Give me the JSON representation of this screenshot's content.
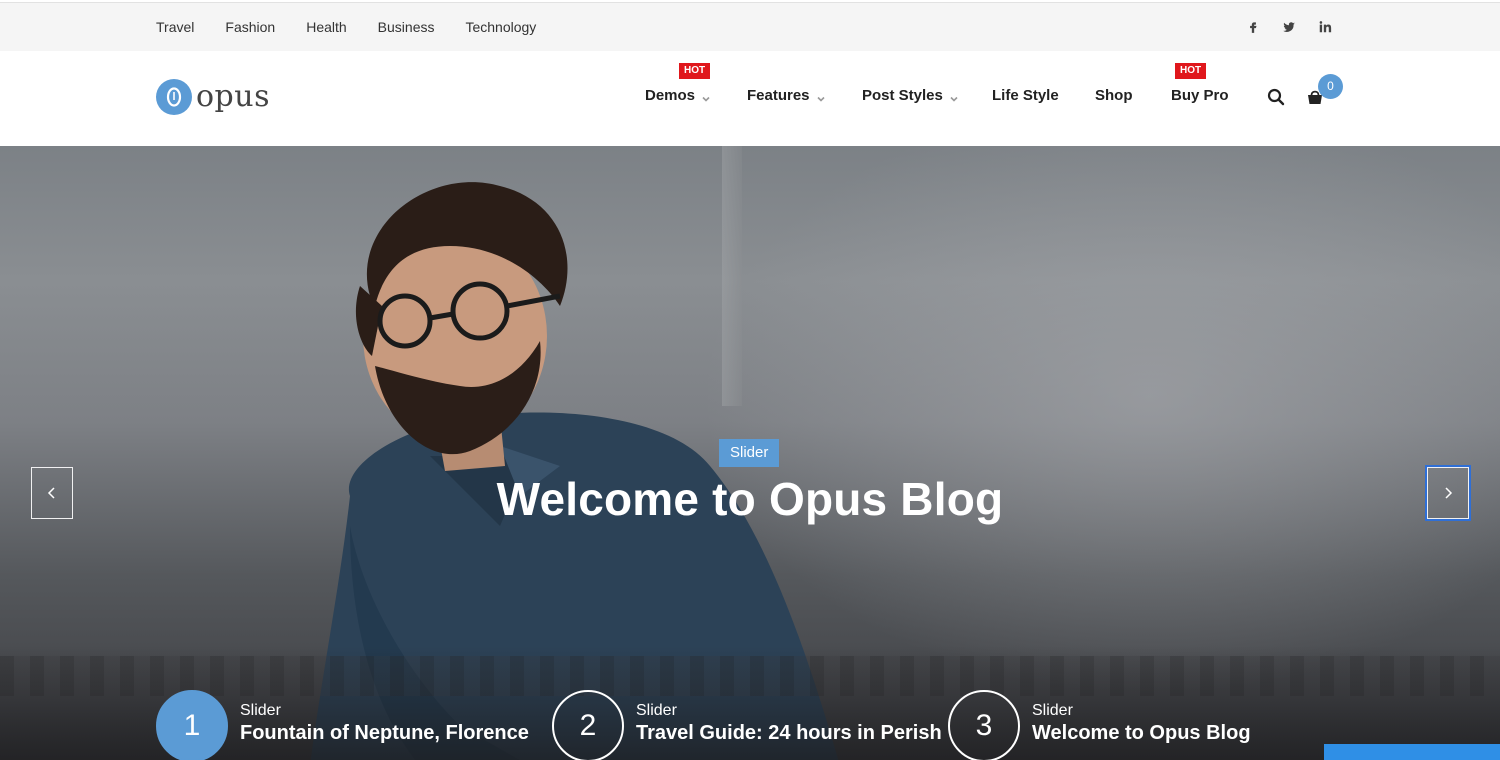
{
  "topbar": {
    "links": [
      "Travel",
      "Fashion",
      "Health",
      "Business",
      "Technology"
    ],
    "social_icons": [
      "facebook-icon",
      "twitter-icon",
      "linkedin-icon"
    ]
  },
  "header": {
    "logo_text": "opus",
    "nav": {
      "demos": {
        "label": "Demos",
        "badge": "HOT"
      },
      "features": {
        "label": "Features"
      },
      "post_styles": {
        "label": "Post Styles"
      },
      "life_style": {
        "label": "Life Style"
      },
      "shop": {
        "label": "Shop"
      },
      "buy_pro": {
        "label": "Buy Pro",
        "badge": "HOT"
      }
    },
    "search_icon": "search-icon",
    "cart_icon": "cart-icon",
    "cart_count": "0"
  },
  "hero": {
    "category": "Slider",
    "title": "Welcome to Opus Blog",
    "prev_icon": "chevron-left-icon",
    "next_icon": "chevron-right-icon"
  },
  "slider_items": [
    {
      "number": "1",
      "category": "Slider",
      "title": "Fountain of Neptune, Florence",
      "active": true
    },
    {
      "number": "2",
      "category": "Slider",
      "title": "Travel Guide: 24 hours in Perish",
      "active": false
    },
    {
      "number": "3",
      "category": "Slider",
      "title": "Welcome to Opus Blog",
      "active": false
    }
  ],
  "colors": {
    "accent": "#5b9bd5",
    "hot_badge": "#e0171c",
    "topbar_bg": "#f5f5f5"
  }
}
